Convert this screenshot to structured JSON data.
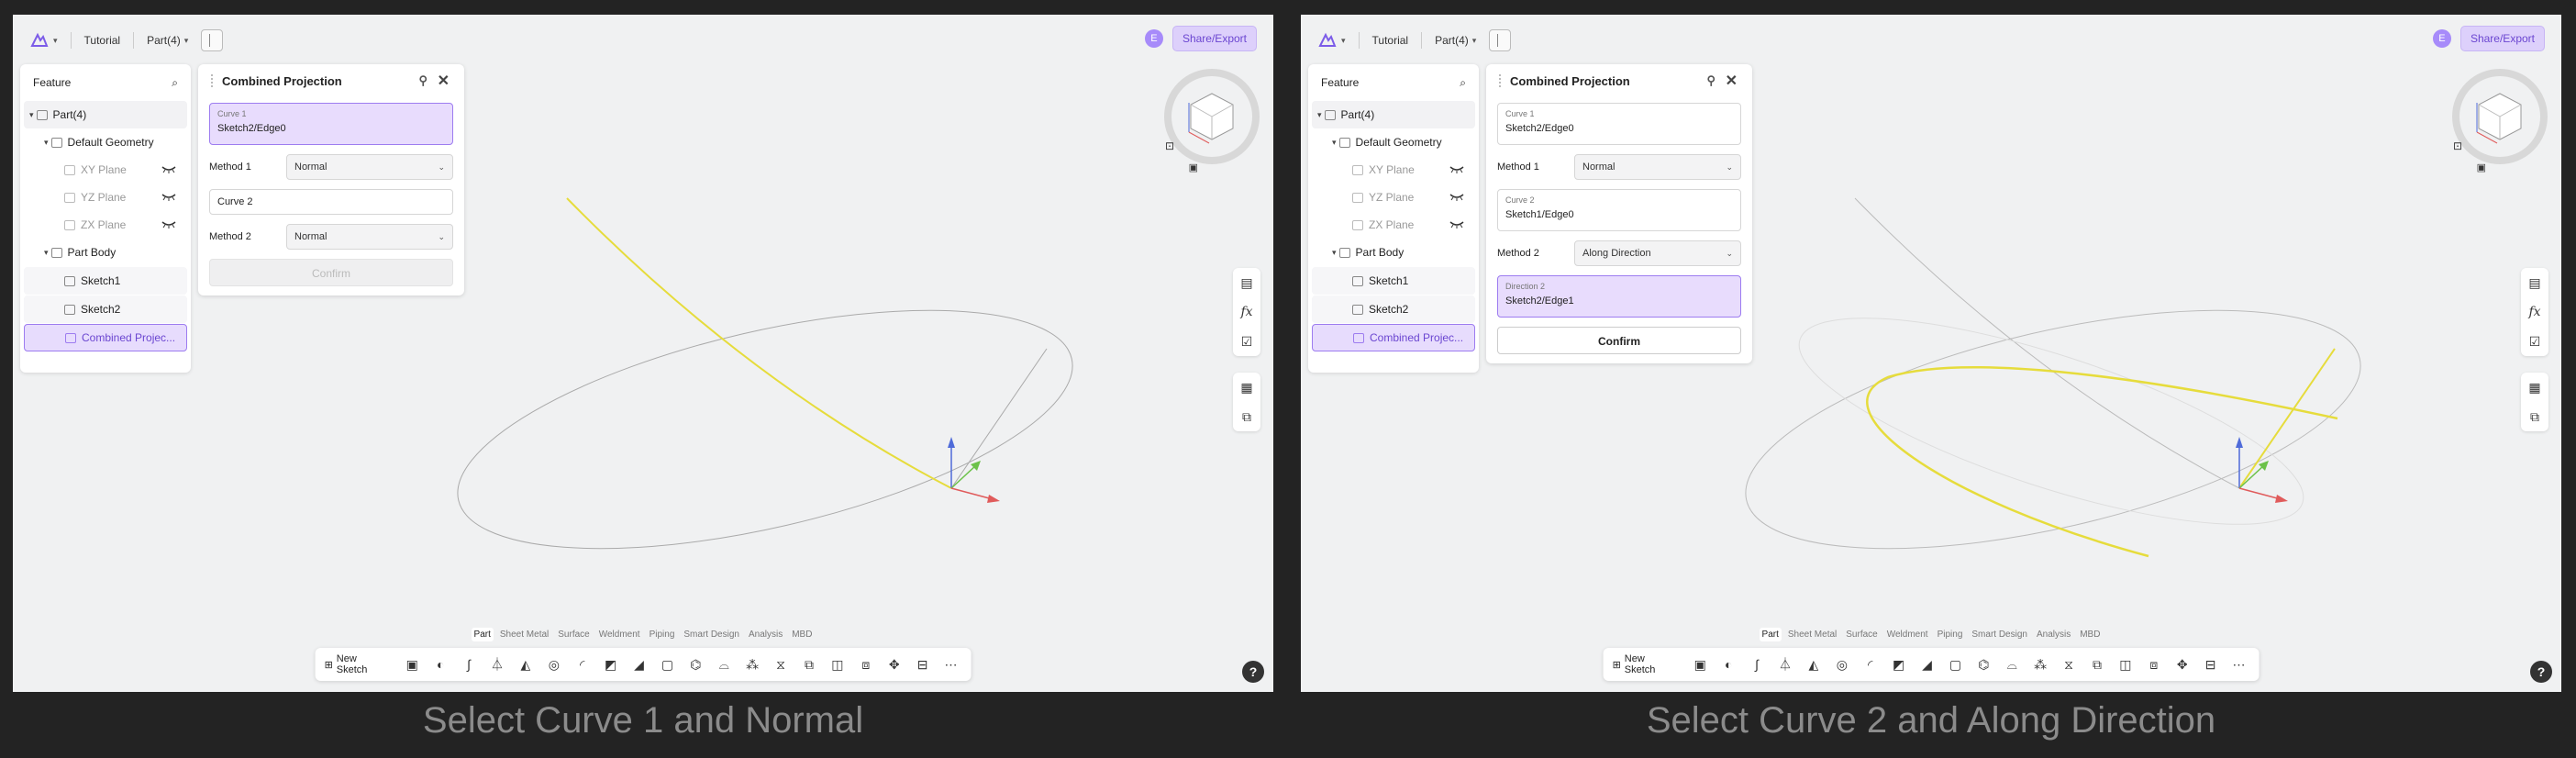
{
  "panels": [
    {
      "toolbar": {
        "breadcrumb_tutorial": "Tutorial",
        "part_selector": "Part(4)"
      },
      "share_button": "Share/Export",
      "avatar_initial": "E",
      "feature_tree": {
        "title": "Feature",
        "part": "Part(4)",
        "default_geometry": "Default Geometry",
        "planes": [
          "XY Plane",
          "YZ Plane",
          "ZX Plane"
        ],
        "part_body": "Part Body",
        "sketches": [
          "Sketch1",
          "Sketch2"
        ],
        "combined": "Combined Projec..."
      },
      "dialog": {
        "title": "Combined Projection",
        "curve1_label": "Curve 1",
        "curve1_value": "Sketch2/Edge0",
        "method1_label": "Method 1",
        "method1_value": "Normal",
        "curve2_label": "Curve 2",
        "curve2_value": "",
        "method2_label": "Method 2",
        "method2_value": "Normal",
        "confirm": "Confirm"
      },
      "tabs": [
        "Part",
        "Sheet Metal",
        "Surface",
        "Weldment",
        "Piping",
        "Smart Design",
        "Analysis",
        "MBD"
      ],
      "new_sketch": "New Sketch",
      "caption": "Select Curve 1 and Normal"
    },
    {
      "toolbar": {
        "breadcrumb_tutorial": "Tutorial",
        "part_selector": "Part(4)"
      },
      "share_button": "Share/Export",
      "avatar_initial": "E",
      "feature_tree": {
        "title": "Feature",
        "part": "Part(4)",
        "default_geometry": "Default Geometry",
        "planes": [
          "XY Plane",
          "YZ Plane",
          "ZX Plane"
        ],
        "part_body": "Part Body",
        "sketches": [
          "Sketch1",
          "Sketch2"
        ],
        "combined": "Combined Projec..."
      },
      "dialog": {
        "title": "Combined Projection",
        "curve1_label": "Curve 1",
        "curve1_value": "Sketch2/Edge0",
        "method1_label": "Method 1",
        "method1_value": "Normal",
        "curve2_label": "Curve 2",
        "curve2_value": "Sketch1/Edge0",
        "method2_label": "Method 2",
        "method2_value": "Along Direction",
        "direction2_label": "Direction 2",
        "direction2_value": "Sketch2/Edge1",
        "confirm": "Confirm"
      },
      "tabs": [
        "Part",
        "Sheet Metal",
        "Surface",
        "Weldment",
        "Piping",
        "Smart Design",
        "Analysis",
        "MBD"
      ],
      "new_sketch": "New Sketch",
      "caption": "Select Curve 2 and Along Direction"
    }
  ],
  "colors": {
    "accent": "#8b5cf6",
    "selected_bg": "#e8dcfd",
    "curve_yellow": "#e6dc3c",
    "panel_bg": "#f0f1f2",
    "frame": "#232323"
  }
}
